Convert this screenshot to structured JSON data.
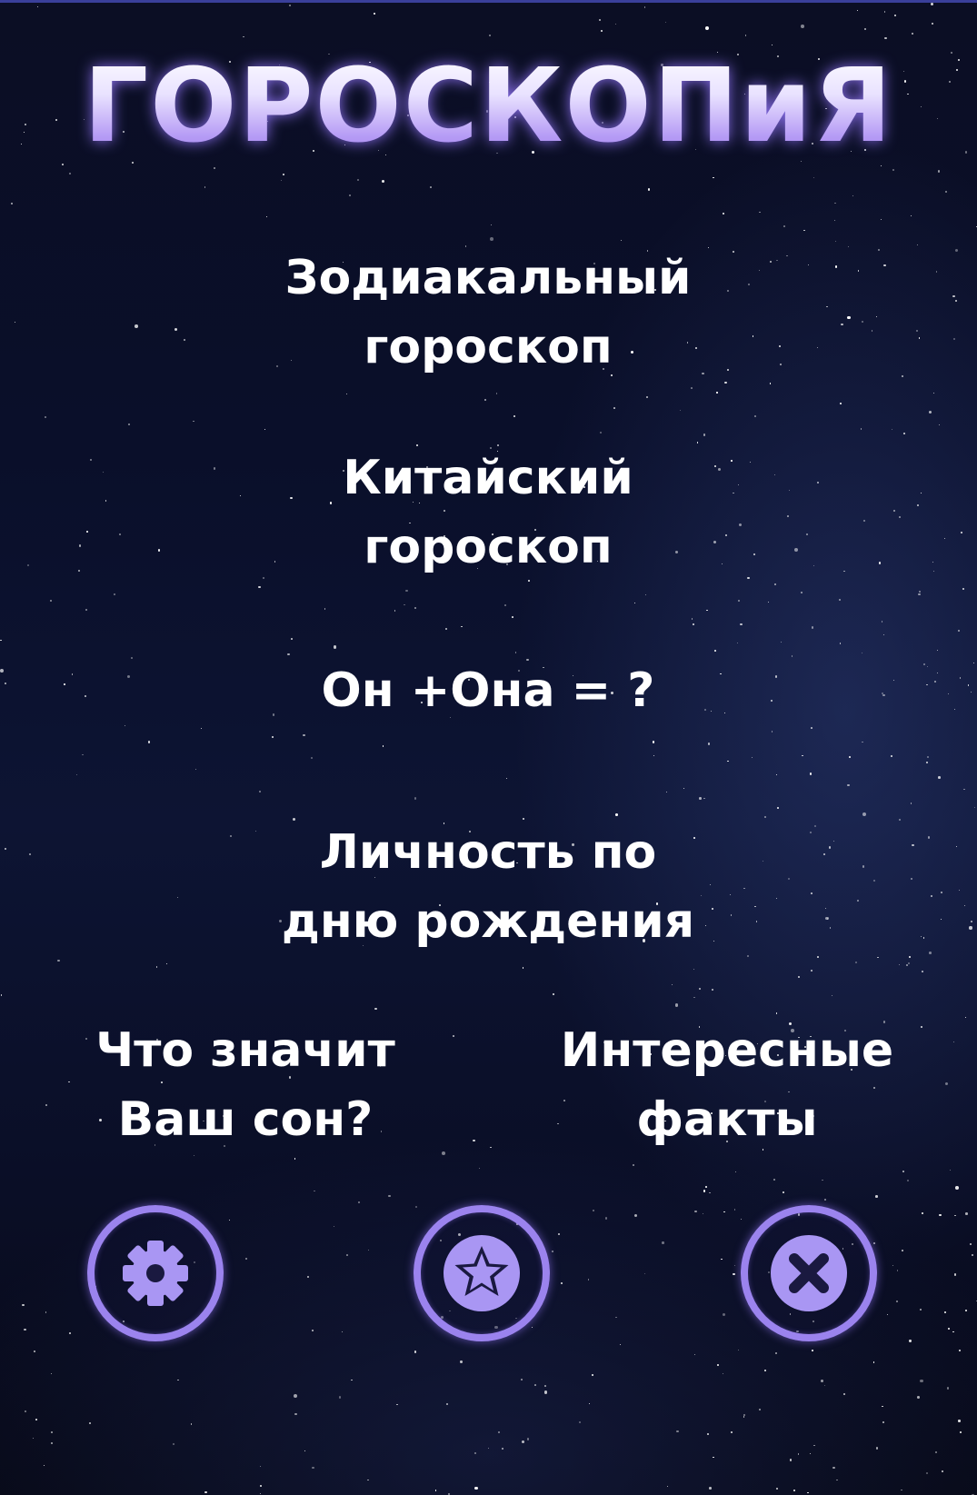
{
  "app": {
    "title": "ГОРОСКОПиЯ"
  },
  "menu": {
    "zodiac": "Зодиакальный\nгороскоп",
    "chinese": "Китайский\nгороскоп",
    "couple": "Он +Она = ?",
    "birthday": "Личность по\nдню рождения",
    "dream": "Что значит\nВаш сон?",
    "facts": "Интересные\nфакты"
  },
  "buttons": {
    "settings_icon": "gear-icon",
    "favorites_icon": "star-icon",
    "close_icon": "close-icon"
  },
  "colors": {
    "accent": "#9b83ee",
    "background": "#0a0f2a",
    "text": "#ffffff"
  }
}
